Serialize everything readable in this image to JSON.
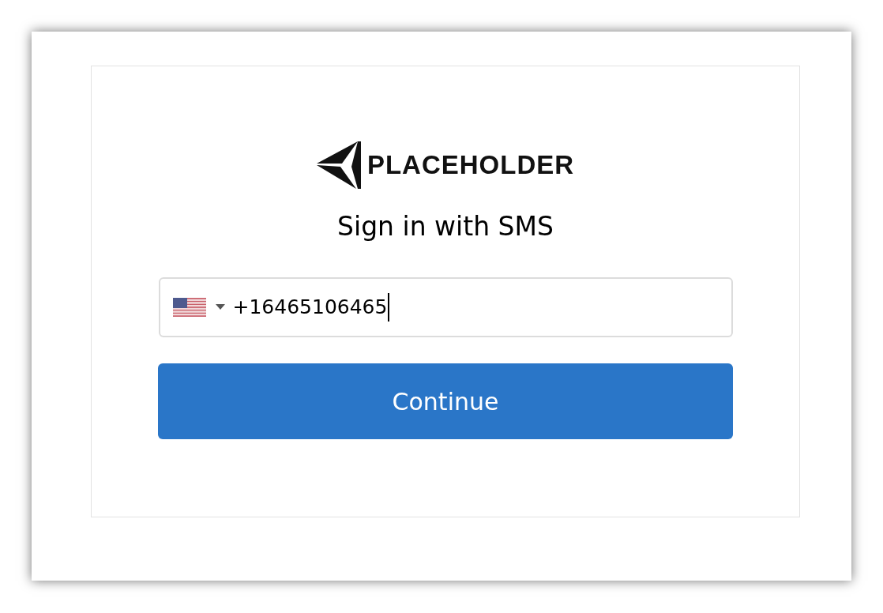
{
  "logo": {
    "text": "PLACEHOLDER"
  },
  "title": "Sign in with SMS",
  "phone_field": {
    "value": "+16465106465",
    "focused": true
  },
  "button": "Continue"
}
